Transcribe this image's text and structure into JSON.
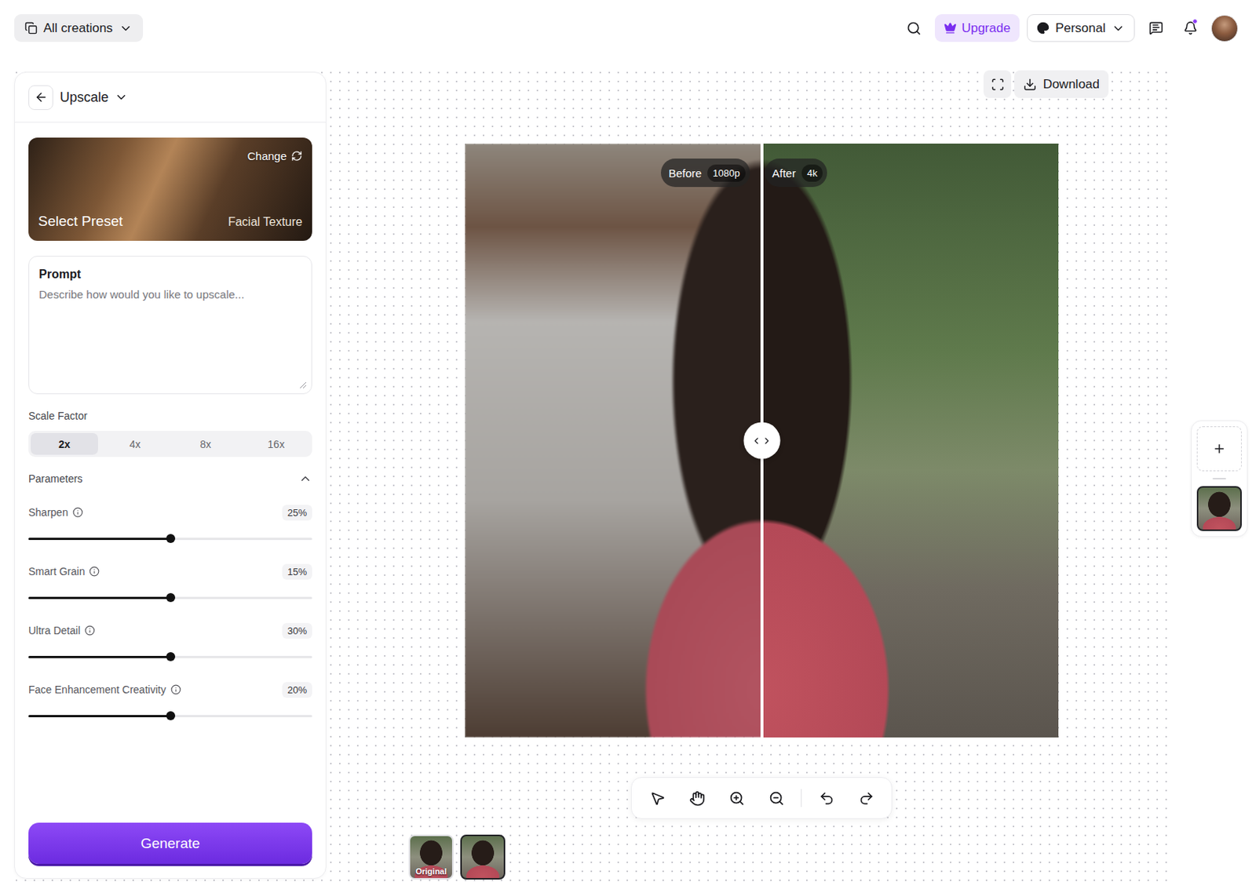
{
  "topbar": {
    "workspace_menu": "All creations",
    "upgrade": "Upgrade",
    "account": "Personal",
    "notifications_unread": true
  },
  "panel": {
    "title": "Upscale",
    "preset": {
      "action": "Change",
      "label": "Select Preset",
      "value": "Facial Texture"
    },
    "prompt": {
      "label": "Prompt",
      "placeholder": "Describe how would you like to upscale...",
      "value": ""
    },
    "scale_factor": {
      "label": "Scale Factor",
      "options": [
        {
          "label": "2x",
          "selected": true
        },
        {
          "label": "4x",
          "selected": false
        },
        {
          "label": "8x",
          "selected": false
        },
        {
          "label": "16x",
          "selected": false
        }
      ]
    },
    "parameters": {
      "label": "Parameters",
      "expanded": true,
      "sliders": [
        {
          "name": "Sharpen",
          "reading": "25%",
          "level": 0.5
        },
        {
          "name": "Smart Grain",
          "reading": "15%",
          "level": 0.5
        },
        {
          "name": "Ultra Detail",
          "reading": "30%",
          "level": 0.5
        },
        {
          "name": "Face Enhancement Creativity",
          "reading": "20%",
          "level": 0.5
        }
      ]
    },
    "generate": "Generate"
  },
  "canvas": {
    "download": "Download",
    "compare": {
      "before": {
        "label": "Before",
        "badge": "1080p"
      },
      "after": {
        "label": "After",
        "badge": "4k"
      },
      "split": 0.5
    },
    "history": [
      {
        "label": "Original",
        "selected": false
      },
      {
        "selected": true
      }
    ]
  },
  "rail": {
    "items": [
      {
        "selected": true
      }
    ]
  }
}
